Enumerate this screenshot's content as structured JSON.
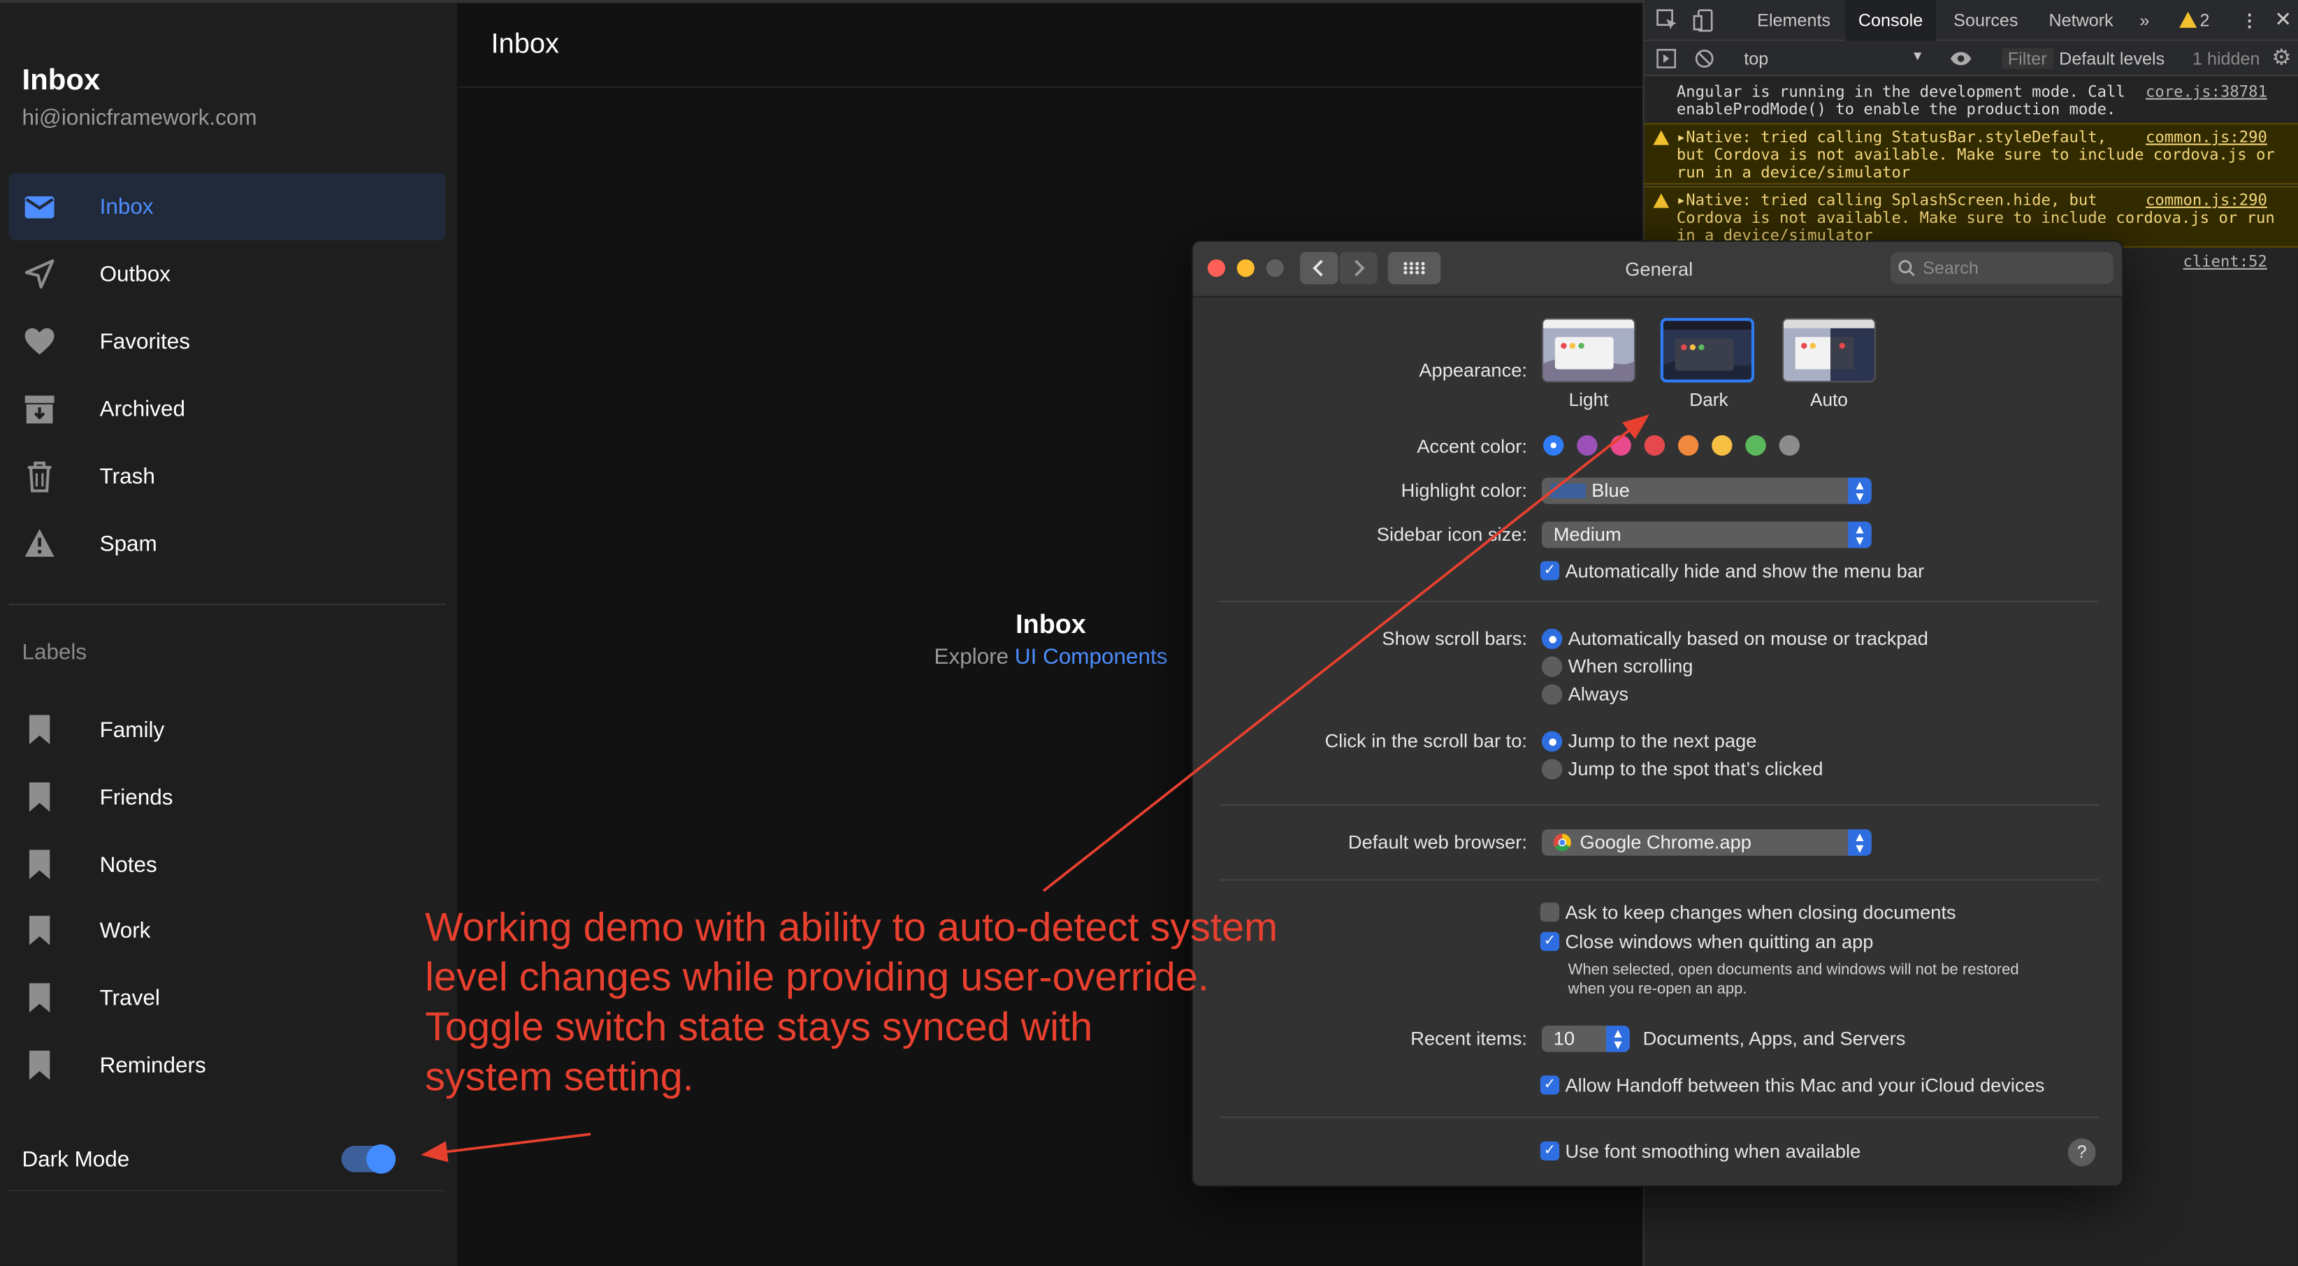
{
  "sidebar": {
    "title": "Inbox",
    "email": "hi@ionicframework.com",
    "items": [
      {
        "label": "Inbox",
        "icon": "mail-icon"
      },
      {
        "label": "Outbox",
        "icon": "paper-plane-icon"
      },
      {
        "label": "Favorites",
        "icon": "heart-icon"
      },
      {
        "label": "Archived",
        "icon": "archive-icon"
      },
      {
        "label": "Trash",
        "icon": "trash-icon"
      },
      {
        "label": "Spam",
        "icon": "warning-icon"
      }
    ],
    "labels_header": "Labels",
    "labels": [
      "Family",
      "Friends",
      "Notes",
      "Work",
      "Travel",
      "Reminders"
    ],
    "dark_mode_label": "Dark Mode",
    "dark_mode_on": true
  },
  "main": {
    "header_title": "Inbox",
    "center_title": "Inbox",
    "center_sub_prefix": "Explore",
    "center_sub_link": "UI Components"
  },
  "devtools": {
    "tabs": [
      "Elements",
      "Console",
      "Sources",
      "Network"
    ],
    "active_tab": "Console",
    "more": "»",
    "warning_count": "2",
    "context": "top",
    "filter_placeholder": "Filter",
    "levels": "Default levels",
    "hidden": "1 hidden",
    "messages": [
      {
        "type": "info",
        "text": "Angular is running in the development mode. Call\nenableProdMode() to enable the production mode.",
        "source": "core.js:38781"
      },
      {
        "type": "warn",
        "text": "▸Native: tried calling StatusBar.styleDefault,\nbut Cordova is not available. Make sure to include cordova.js or\nrun in a device/simulator",
        "source": "common.js:290"
      },
      {
        "type": "warn",
        "text": "▸Native: tried calling SplashScreen.hide, but\nCordova is not available. Make sure to include cordova.js or run\nin a device/simulator",
        "source": "common.js:290"
      },
      {
        "type": "info",
        "text": "",
        "source": "client:52"
      }
    ]
  },
  "prefs": {
    "title": "General",
    "search_placeholder": "Search",
    "appearance_label": "Appearance:",
    "appearance_options": [
      "Light",
      "Dark",
      "Auto"
    ],
    "appearance_selected": "Dark",
    "accent_label": "Accent color:",
    "accent_colors": [
      "#2f7cf6",
      "#9b51b8",
      "#e84a8c",
      "#e5484d",
      "#f0883e",
      "#f5c043",
      "#5cb85c",
      "#8c8c8c"
    ],
    "highlight_label": "Highlight color:",
    "highlight_value": "Blue",
    "sidebar_label": "Sidebar icon size:",
    "sidebar_value": "Medium",
    "menubar_label": "Automatically hide and show the menu bar",
    "scroll_label": "Show scroll bars:",
    "scroll_options": [
      "Automatically based on mouse or trackpad",
      "When scrolling",
      "Always"
    ],
    "click_label": "Click in the scroll bar to:",
    "click_options": [
      "Jump to the next page",
      "Jump to the spot that’s clicked"
    ],
    "browser_label": "Default web browser:",
    "browser_value": "Google Chrome.app",
    "ask_keep_label": "Ask to keep changes when closing documents",
    "close_windows_label": "Close windows when quitting an app",
    "close_windows_note": "When selected, open documents and windows will not be restored\nwhen you re-open an app.",
    "recent_label": "Recent items:",
    "recent_value": "10",
    "recent_suffix": "Documents, Apps, and Servers",
    "handoff_label": "Allow Handoff between this Mac and your iCloud devices",
    "smoothing_label": "Use font smoothing when available",
    "help": "?"
  },
  "annotation": {
    "text": "Working demo with ability to auto-detect system\nlevel changes while providing user-override.\nToggle switch state stays synced with\nsystem setting.",
    "color": "#e8402f"
  }
}
